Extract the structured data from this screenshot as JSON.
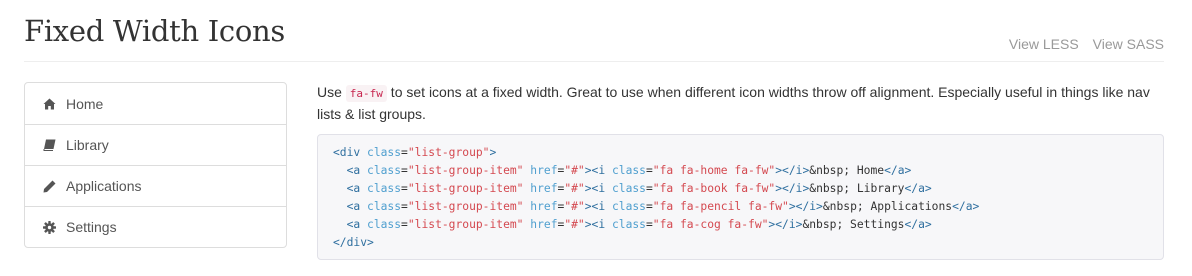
{
  "header": {
    "title": "Fixed Width Icons",
    "links": [
      "View LESS",
      "View SASS"
    ]
  },
  "list_group": {
    "items": [
      {
        "label": "Home",
        "icon": "home-icon"
      },
      {
        "label": "Library",
        "icon": "book-icon"
      },
      {
        "label": "Applications",
        "icon": "pencil-icon"
      },
      {
        "label": "Settings",
        "icon": "cog-icon"
      }
    ]
  },
  "description": {
    "before": "Use ",
    "code": "fa-fw",
    "after": " to set icons at a fixed width. Great to use when different icon widths throw off alignment. Especially useful in things like nav lists & list groups."
  },
  "code_sample": {
    "lines": [
      "<div class=\"list-group\">",
      "  <a class=\"list-group-item\" href=\"#\"><i class=\"fa fa-home fa-fw\"></i>&nbsp; Home</a>",
      "  <a class=\"list-group-item\" href=\"#\"><i class=\"fa fa-book fa-fw\"></i>&nbsp; Library</a>",
      "  <a class=\"list-group-item\" href=\"#\"><i class=\"fa fa-pencil fa-fw\"></i>&nbsp; Applications</a>",
      "  <a class=\"list-group-item\" href=\"#\"><i class=\"fa fa-cog fa-fw\"></i>&nbsp; Settings</a>",
      "</div>"
    ]
  },
  "colors": {
    "tag": "#2f6f9f",
    "attribute": "#4f9fcf",
    "string": "#d44950",
    "inline_code": "#c7254e"
  }
}
